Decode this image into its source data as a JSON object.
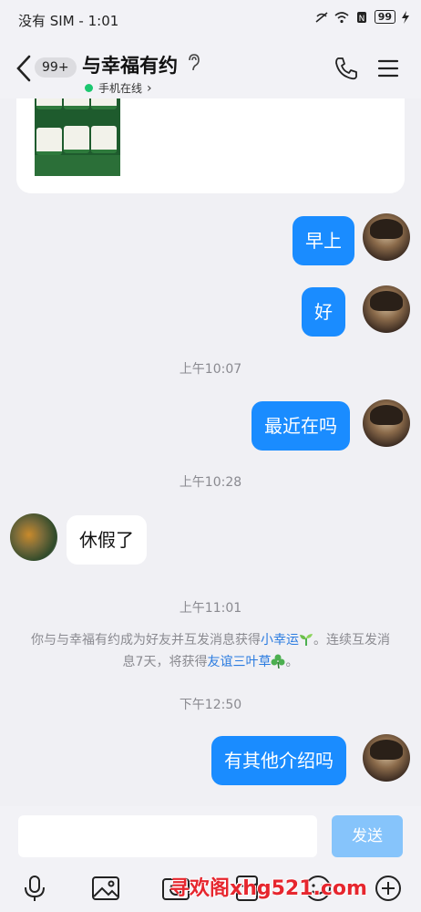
{
  "statusbar": {
    "left_text": "没有 SIM - 1:01",
    "battery": "99"
  },
  "header": {
    "unread_badge": "99+",
    "title": "与幸福有约",
    "online_status": "手机在线",
    "online_chevron": "›"
  },
  "messages": {
    "m1": "早上",
    "m2": "好",
    "t1": "上午10:07",
    "m3": "最近在吗",
    "t2": "上午10:28",
    "m4": "休假了",
    "t3": "上午11:01",
    "sys_part1": "你与与幸福有约成为好友并互发消息获得",
    "sys_link1": "小幸运",
    "sys_part2": "。连续互发消息7天，将获得",
    "sys_link2": "友谊三叶草",
    "sys_part3": "。",
    "t4": "下午12:50",
    "m5": "有其他介绍吗"
  },
  "input": {
    "send_label": "发送"
  },
  "watermark": "寻欢阁xhg521.com",
  "colors": {
    "accent": "#1a8cff",
    "online": "#1cc770",
    "send_disabled": "#86c4fb"
  }
}
